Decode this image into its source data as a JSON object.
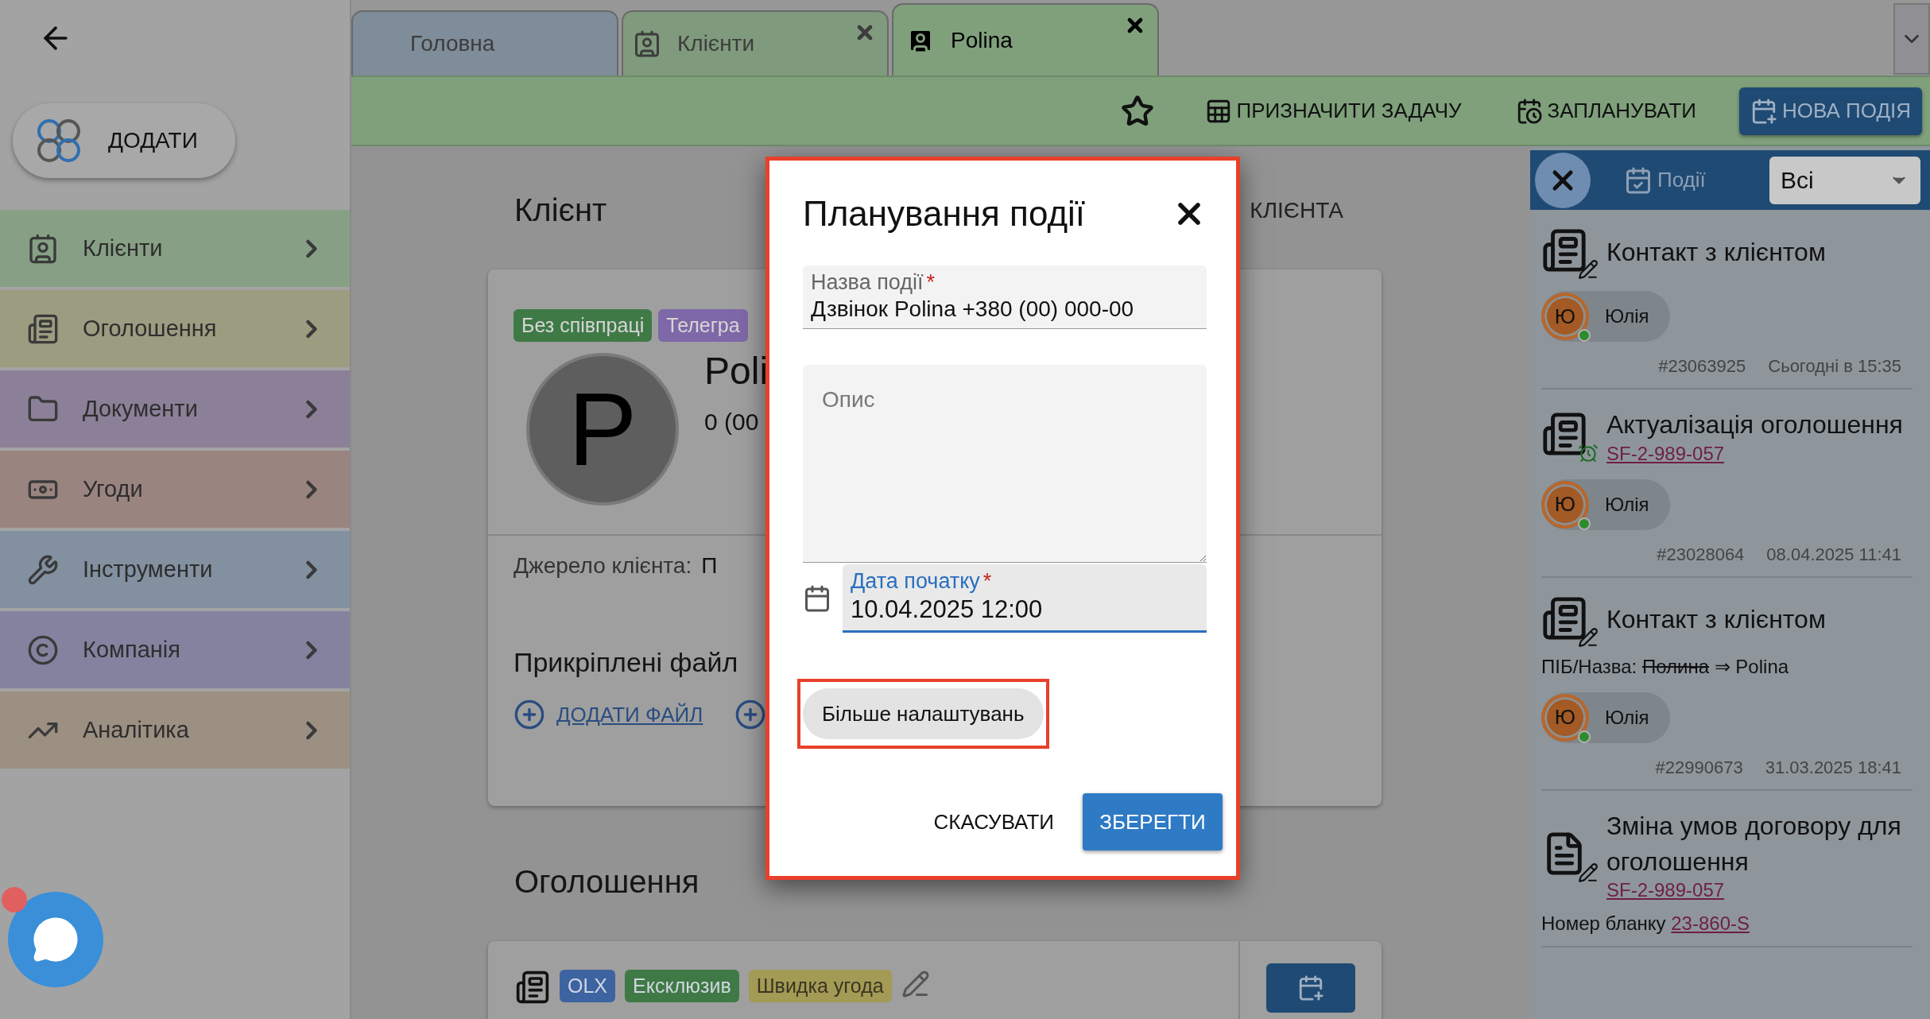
{
  "sidebar": {
    "add_button": "ДОДАТИ",
    "items": [
      {
        "label": "Клієнти",
        "kind": "clients",
        "color": "#87a085"
      },
      {
        "label": "Оголошення",
        "kind": "listings",
        "color": "#9c9c80"
      },
      {
        "label": "Документи",
        "kind": "documents",
        "color": "#8c8098"
      },
      {
        "label": "Угоди",
        "kind": "deals",
        "color": "#9a8480"
      },
      {
        "label": "Інструменти",
        "kind": "tools",
        "color": "#8290a0"
      },
      {
        "label": "Компанія",
        "kind": "company",
        "color": "#8383a0"
      },
      {
        "label": "Аналітика",
        "kind": "analytics",
        "color": "#9c9082"
      }
    ]
  },
  "tabs": [
    {
      "label": "Головна",
      "kind": "home",
      "selected": false,
      "closable": false,
      "color": "#7f8c99"
    },
    {
      "label": "Клієнти",
      "kind": "list",
      "selected": false,
      "closable": true,
      "color": "#7f9a7c"
    },
    {
      "label": "Polina",
      "kind": "person",
      "selected": true,
      "closable": true,
      "color": "#7fa07b"
    }
  ],
  "toolbar": {
    "actions": [
      {
        "label": "ПРИЗНАЧИТИ ЗАДАЧУ",
        "kind": "task"
      },
      {
        "label": "ЗАПЛАНУВАТИ",
        "kind": "schedule"
      },
      {
        "label": "НОВА ПОДІЯ",
        "kind": "primary"
      }
    ]
  },
  "client_section": {
    "heading": "Клієнт",
    "header_action": "КЛІЄНТА",
    "tags": [
      {
        "label": "Без співпраці",
        "color": "#3f7a46"
      },
      {
        "label": "Телегра",
        "color": "#7e68a8"
      }
    ],
    "avatar_letter": "P",
    "name": "Poli",
    "phone": "0 (00",
    "source_label": "Джерело клієнта:",
    "source_value": "П",
    "files_heading": "Прикріплені файл",
    "add_file": "ДОДАТИ ФАЙЛ"
  },
  "listings_section": {
    "heading": "Оголошення",
    "tags": [
      {
        "label": "OLX",
        "color": "#3d63a0"
      },
      {
        "label": "Ексклюзив",
        "color": "#3f7a46"
      },
      {
        "label": "Швидка угода",
        "color": "#a39a55"
      }
    ]
  },
  "events_panel": {
    "title": "Події",
    "filter": "Всі",
    "events": [
      {
        "kind": "contact",
        "title": "Контакт з клієнтом",
        "user": {
          "initial": "Ю",
          "name": "Юлія",
          "online": true
        },
        "id": "#23063925",
        "time": "Сьогодні в 15:35"
      },
      {
        "kind": "update",
        "title": "Актуалізація оголошення",
        "link": "SF-2-989-057",
        "user": {
          "initial": "Ю",
          "name": "Юлія",
          "online": true
        },
        "id": "#23028064",
        "time": "08.04.2025 11:41"
      },
      {
        "kind": "contact",
        "title": "Контакт з клієнтом",
        "change": {
          "label": "ПІБ/Назва:",
          "old": "Полина",
          "arrow": "⇒",
          "new": "Polina"
        },
        "user": {
          "initial": "Ю",
          "name": "Юлія",
          "online": true
        },
        "id": "#22990673",
        "time": "31.03.2025 18:41"
      },
      {
        "kind": "contract",
        "title": "Зміна умов договору для оголошення",
        "link": "SF-2-989-057",
        "note": "Номер бланку",
        "note_link": "23-860-S"
      }
    ]
  },
  "dialog": {
    "title": "Планування події",
    "fields": [
      {
        "kind": "text",
        "label": "Назва події",
        "required_mark": "*",
        "value": "Дзвінок Polina +380 (00) 000-00",
        "focused": false
      },
      {
        "kind": "textarea",
        "placeholder": "Опис"
      },
      {
        "kind": "date",
        "label": "Дата початку",
        "required_mark": "*",
        "value": "10.04.2025 12:00",
        "focused": true
      }
    ],
    "more_button": "Більше налаштувань",
    "cancel": "СКАСУВАТИ",
    "save": "ЗБЕРЕГТИ"
  }
}
